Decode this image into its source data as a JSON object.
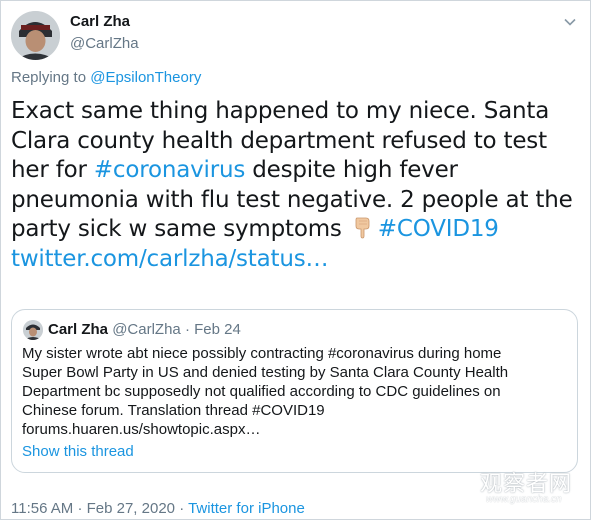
{
  "author": {
    "display_name": "Carl Zha",
    "handle": "@CarlZha",
    "avatar_icon": "profile-avatar-icon"
  },
  "reply": {
    "prefix": "Replying to",
    "mention": "@EpsilonTheory"
  },
  "tweet": {
    "text_1": "Exact same thing happened to my niece. Santa Clara county health department refused to test her for ",
    "hashtag_1": "#coronavirus",
    "text_2": " despite high fever pneumonia with flu test negative. 2 people at the party sick w same symptoms ",
    "emoji": "pointing-down-emoji",
    "hashtag_2": "#COVID19",
    "link": "twitter.com/carlzha/status…"
  },
  "quote": {
    "display_name": "Carl Zha",
    "handle": "@CarlZha",
    "separator": "·",
    "date": "Feb 24",
    "lines": [
      "My sister wrote abt niece possibly contracting #coronavirus during home",
      "Super Bowl Party in US and denied testing by Santa Clara County Health",
      "Department bc supposedly not qualified according to CDC guidelines on",
      "Chinese forum. Translation thread #COVID19",
      "forums.huaren.us/showtopic.aspx…"
    ],
    "show_thread": "Show this thread"
  },
  "footer": {
    "time": "11:56 AM",
    "sep1": "·",
    "date": "Feb 27, 2020",
    "sep2": "·",
    "source": "Twitter for iPhone"
  },
  "watermark": {
    "cn": "观察者网",
    "en": "www.guancha.cn"
  },
  "colors": {
    "link": "#1b95e0",
    "muted": "#657786",
    "text": "#14171a",
    "border": "#ccd6dd"
  }
}
